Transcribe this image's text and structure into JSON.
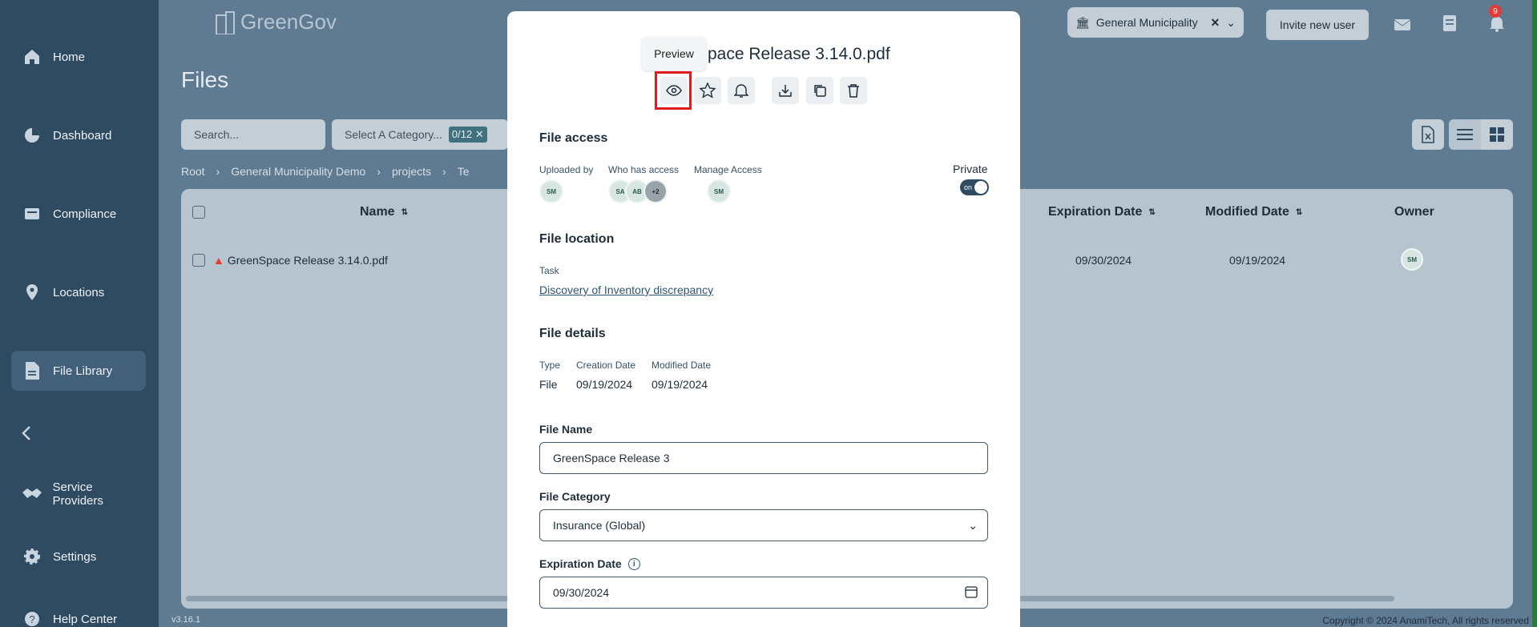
{
  "app": {
    "logo": "GreenGov",
    "version": "v3.16.1",
    "copyright": "Copyright © 2024 AnamiTech, All rights reserved"
  },
  "sidebar": {
    "items": [
      {
        "label": "Home",
        "icon": "home-icon"
      },
      {
        "label": "Dashboard",
        "icon": "dashboard-icon"
      },
      {
        "label": "Compliance",
        "icon": "compliance-icon"
      },
      {
        "label": "Locations",
        "icon": "location-pin-icon"
      },
      {
        "label": "File Library",
        "icon": "file-icon"
      },
      {
        "label": "Service Providers",
        "icon": "handshake-icon"
      },
      {
        "label": "Settings",
        "icon": "gear-icon"
      },
      {
        "label": "Help Center",
        "icon": "help-icon"
      }
    ]
  },
  "header": {
    "municipality": "General Municipality",
    "invite_label": "Invite new user",
    "notification_count": "9"
  },
  "page": {
    "title": "Files",
    "search_placeholder": "Search...",
    "category_placeholder": "Select A Category...",
    "category_count": "0/12"
  },
  "breadcrumbs": [
    "Root",
    "General Municipality Demo",
    "projects",
    "Te"
  ],
  "table": {
    "columns": {
      "name": "Name",
      "expiration": "Expiration Date",
      "modified": "Modified Date",
      "owner": "Owner"
    },
    "rows": [
      {
        "name": "GreenSpace Release 3.14.0.pdf",
        "expiration": "09/30/2024",
        "modified": "09/19/2024",
        "owner": "SM"
      }
    ]
  },
  "modal": {
    "title": "pace Release 3.14.0.pdf",
    "tooltip": "Preview",
    "access": {
      "heading": "File access",
      "uploaded_by": "Uploaded by",
      "who_has_access": "Who has access",
      "manage_access": "Manage Access",
      "private_label": "Private",
      "toggle_text": "on",
      "uploader": "SM",
      "access_users": [
        "SA",
        "AB"
      ],
      "more": "+2",
      "manager": "SM"
    },
    "location": {
      "heading": "File location",
      "task_label": "Task",
      "task_link": "Discovery of Inventory discrepancy"
    },
    "details": {
      "heading": "File details",
      "type_label": "Type",
      "type_value": "File",
      "creation_label": "Creation Date",
      "creation_value": "09/19/2024",
      "modified_label": "Modified Date",
      "modified_value": "09/19/2024"
    },
    "form": {
      "name_label": "File Name",
      "name_value": "GreenSpace Release 3",
      "category_label": "File Category",
      "category_value": "Insurance (Global)",
      "expiration_label": "Expiration Date",
      "expiration_value": "09/30/2024"
    }
  },
  "colors": {
    "sidebar": "#2f4b62",
    "background": "#5e7b92",
    "accent": "#41717e",
    "highlight": "#e01b1b"
  }
}
